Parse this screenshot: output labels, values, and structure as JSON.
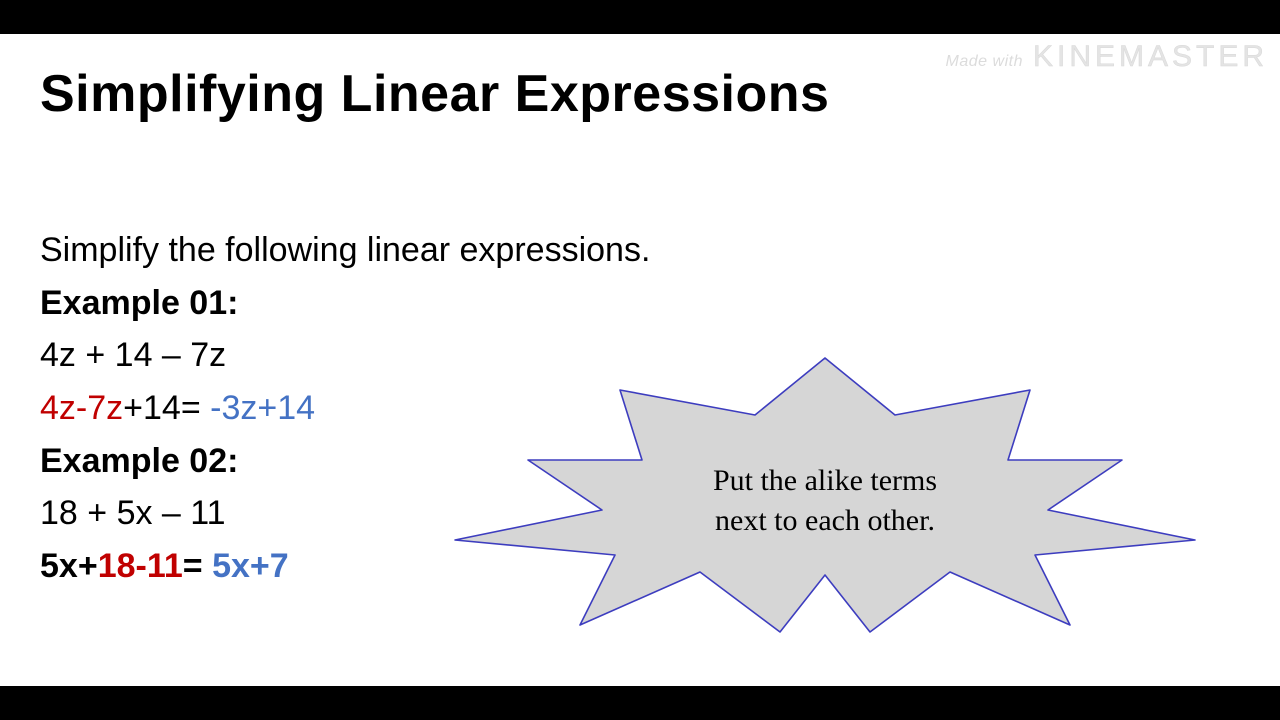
{
  "watermark": {
    "small": "Made with",
    "big": "KINEMASTER"
  },
  "title": "Simplifying Linear Expressions",
  "instruction": "Simplify the following linear expressions.",
  "ex1": {
    "label": "Example 01:",
    "line1": "4z + 14 – 7z",
    "step_red": "4z-7z",
    "step_mid": "+14= ",
    "step_blue": "-3z+14"
  },
  "ex2": {
    "label": "Example 02:",
    "line1": "18 + 5x – 11",
    "step_a": "5x+",
    "step_red": "18-11",
    "step_eq": "= ",
    "step_blue": "5x+7"
  },
  "callout": {
    "line1": "Put the alike terms",
    "line2": "next to each other."
  }
}
